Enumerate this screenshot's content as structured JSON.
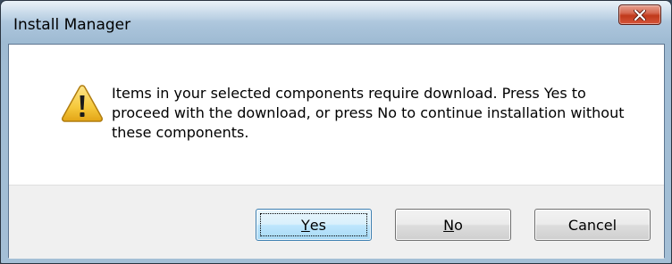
{
  "window": {
    "title": "Install Manager"
  },
  "dialog": {
    "icon": "warning-icon",
    "message": "Items in your selected components require download. Press Yes to proceed with the download, or press No to continue installation without these components."
  },
  "buttons": {
    "yes": {
      "accel": "Y",
      "rest": "es"
    },
    "no": {
      "accel": "N",
      "rest": "o"
    },
    "cancel": {
      "label": "Cancel"
    }
  },
  "colors": {
    "close_button": "#c0391b",
    "warning_fill": "#f6c93c",
    "default_button_border": "#3c7fb1"
  }
}
